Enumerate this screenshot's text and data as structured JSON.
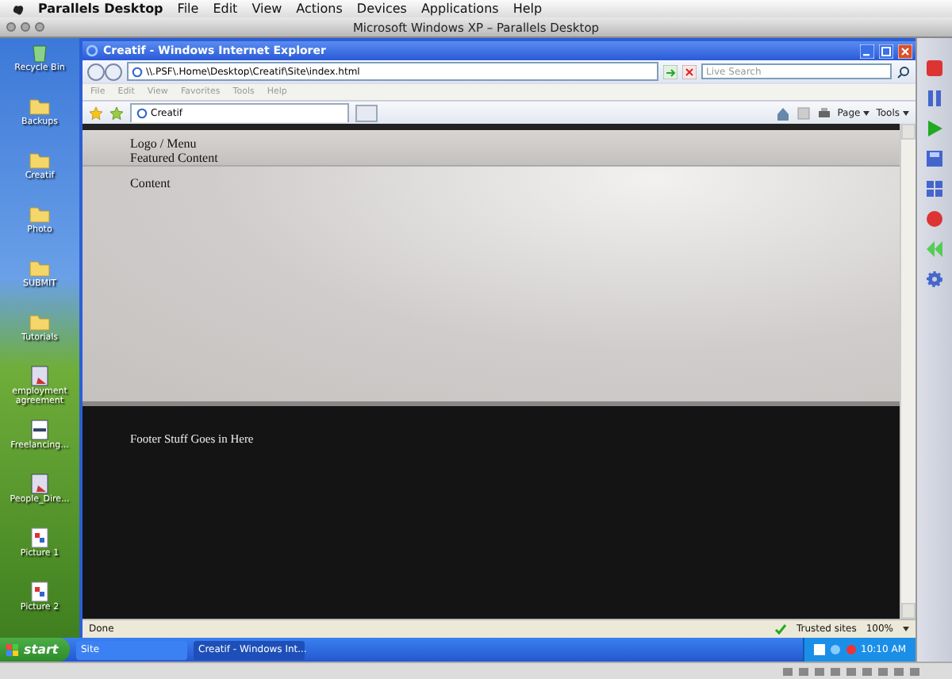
{
  "mac_menu": {
    "app": "Parallels Desktop",
    "items": [
      "File",
      "Edit",
      "View",
      "Actions",
      "Devices",
      "Applications",
      "Help"
    ]
  },
  "vm_window": {
    "title": "Microsoft Windows XP – Parallels Desktop"
  },
  "desktop_icons": [
    {
      "label": "Recycle Bin",
      "kind": "recycle"
    },
    {
      "label": "Backups",
      "kind": "folder"
    },
    {
      "label": "Creatif",
      "kind": "folder"
    },
    {
      "label": "Photo",
      "kind": "folder"
    },
    {
      "label": "SUBMIT",
      "kind": "folder"
    },
    {
      "label": "Tutorials",
      "kind": "folder"
    },
    {
      "label": "employment agreement",
      "kind": "document"
    },
    {
      "label": "Freelancing...",
      "kind": "sheet"
    },
    {
      "label": "People_Dire...",
      "kind": "document"
    },
    {
      "label": "Picture 1",
      "kind": "picture"
    },
    {
      "label": "Picture 2",
      "kind": "picture"
    }
  ],
  "browser": {
    "title": "Creatif - Windows Internet Explorer",
    "address": "\\\\.PSF\\.Home\\Desktop\\Creatif\\Site\\index.html",
    "search": {
      "placeholder": "Live Search"
    },
    "menu": [
      "File",
      "Edit",
      "View",
      "Favorites",
      "Tools",
      "Help"
    ],
    "tabs": [
      {
        "label": "Creatif",
        "selected": true
      }
    ],
    "commands": [
      "Page",
      "Tools"
    ],
    "page": {
      "header_lines": [
        "Logo / Menu",
        "Featured Content"
      ],
      "content": "Content",
      "footer": "Footer Stuff Goes in Here"
    },
    "status": {
      "text": "Done",
      "zone": "Trusted sites",
      "zoom": "100%"
    }
  },
  "taskbar": {
    "start": "start",
    "items": [
      {
        "label": "Site",
        "selected": false
      },
      {
        "label": "Creatif - Windows Int...",
        "selected": true
      }
    ],
    "clock": "10:10 AM"
  }
}
